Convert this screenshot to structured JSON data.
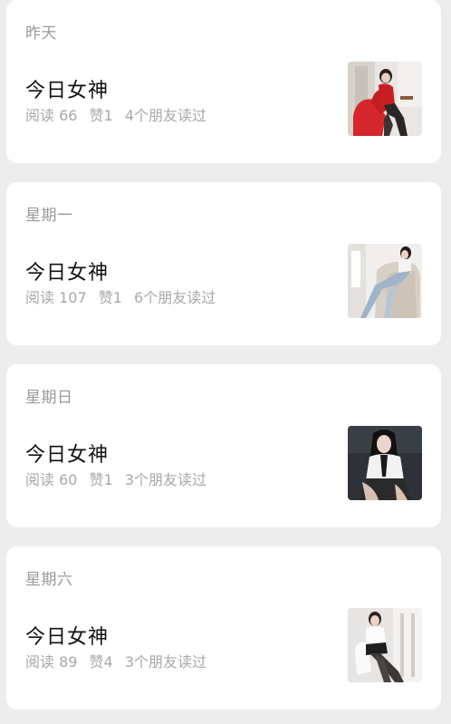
{
  "articles": [
    {
      "day": "昨天",
      "title": "今日女神",
      "reads": "阅读 66",
      "likes": "赞1",
      "friends": "4个朋友读过",
      "thumb_icon": "photo-red-chair"
    },
    {
      "day": "星期一",
      "title": "今日女神",
      "reads": "阅读 107",
      "likes": "赞1",
      "friends": "6个朋友读过",
      "thumb_icon": "photo-sofa-denim"
    },
    {
      "day": "星期日",
      "title": "今日女神",
      "reads": "阅读 60",
      "likes": "赞1",
      "friends": "3个朋友读过",
      "thumb_icon": "photo-dark-room"
    },
    {
      "day": "星期六",
      "title": "今日女神",
      "reads": "阅读 89",
      "likes": "赞4",
      "friends": "3个朋友读过",
      "thumb_icon": "photo-white-chair"
    }
  ]
}
